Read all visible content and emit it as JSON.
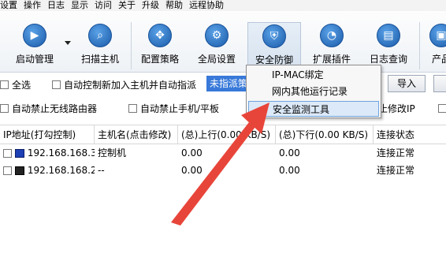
{
  "menubar": {
    "items": [
      "设置",
      "操作",
      "日志",
      "显示",
      "访问",
      "关于",
      "升级",
      "帮助",
      "远程协助"
    ]
  },
  "toolbar": {
    "buttons": [
      {
        "label": "启动管理",
        "icon": "play-icon"
      },
      {
        "label": "扫描主机",
        "icon": "magnifier-icon"
      },
      {
        "label": "配置策略",
        "icon": "gear-cross-icon"
      },
      {
        "label": "全局设置",
        "icon": "gear-icon"
      },
      {
        "label": "安全防御",
        "icon": "shield-icon"
      },
      {
        "label": "扩展插件",
        "icon": "plug-icon"
      },
      {
        "label": "日志查询",
        "icon": "log-icon"
      },
      {
        "label": "产品",
        "icon": "product-icon"
      }
    ]
  },
  "options": {
    "select_all": "全选",
    "auto_control": "自动控制新加入主机并自动指派",
    "policy_combo": "未指派策",
    "import_button": "导入",
    "block_wireless": "自动禁止无线路由器",
    "block_mobile": "自动禁止手机/平板",
    "modify_ip": "止修改IP"
  },
  "popup": {
    "items": [
      "IP-MAC绑定",
      "网内其他运行记录",
      "安全监测工具"
    ]
  },
  "table": {
    "headers": [
      "IP地址(打勾控制)",
      "主机名(点击修改)",
      "(总)上行(0.00 KB/S)",
      "(总)下行(0.00 KB/S)",
      "连接状态"
    ],
    "rows": [
      {
        "ip": "192.168.168.3",
        "host": "控制机",
        "up": "0.00",
        "down": "0.00",
        "status": "连接正常"
      },
      {
        "ip": "192.168.168.2",
        "host": "--",
        "up": "0.00",
        "down": "0.00",
        "status": "连接正常"
      }
    ]
  },
  "colors": {
    "accent": "#3879d9",
    "arrow": "#e8453a"
  }
}
